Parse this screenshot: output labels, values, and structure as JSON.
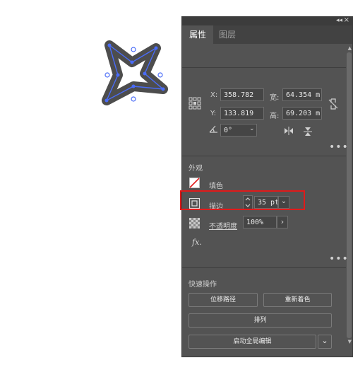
{
  "panel": {
    "tabs": [
      {
        "label": "属性",
        "active": true
      },
      {
        "label": "图层",
        "active": false
      }
    ],
    "collapse_icon": "double-chevron-left-icon",
    "close_icon": "close-icon"
  },
  "transform": {
    "x_label": "X:",
    "x_value": "358.782",
    "y_label": "Y:",
    "y_value": "133.819",
    "width_label": "宽:",
    "width_value": "64.354 m",
    "height_label": "高:",
    "height_value": "69.203 m",
    "rotation_value": "0°",
    "icons": [
      "reference-point-grid-icon",
      "constrain-proportions-icon",
      "rotate-angle-icon",
      "flip-horizontal-icon",
      "flip-vertical-icon"
    ]
  },
  "appearance": {
    "title": "外观",
    "fill_label": "填色",
    "stroke_label": "描边",
    "stroke_value": "35 pt",
    "opacity_label": "不透明度",
    "opacity_value": "100%",
    "fx_label": "fx."
  },
  "quick_actions": {
    "title": "快速操作",
    "offset_path": "位移路径",
    "recolor": "重新着色",
    "arrange": "排列",
    "global_edit": "启动全局编辑"
  },
  "colors": {
    "panel_bg": "#535353",
    "highlight": "#e11a1a",
    "selection": "#4a6cf7",
    "shape_stroke": "#4d4d4d"
  }
}
